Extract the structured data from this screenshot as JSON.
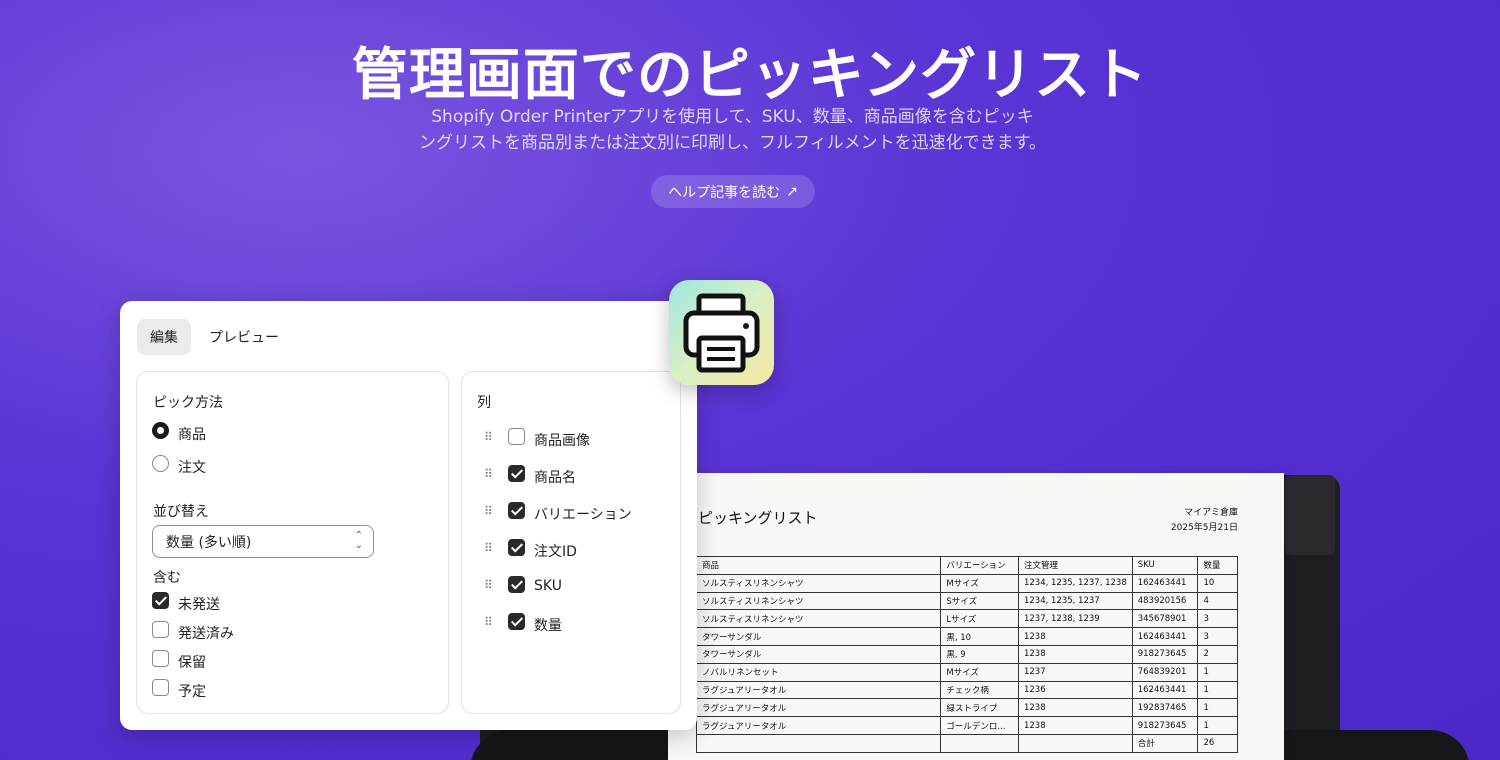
{
  "hero": {
    "title": "管理画面でのピッキングリスト",
    "subtitle_line1": "Shopify Order Printerアプリを使用して、SKU、数量、商品画像を含むピッキ",
    "subtitle_line2": "ングリストを商品別または注文別に印刷し、フルフィルメントを迅速化できます。",
    "help_label": "ヘルプ記事を読む",
    "help_icon": "arrow-up-right-icon"
  },
  "editor": {
    "tabs": [
      {
        "label": "編集",
        "active": true
      },
      {
        "label": "プレビュー",
        "active": false
      }
    ],
    "pick_method": {
      "label": "ピック方法",
      "options": [
        {
          "label": "商品",
          "checked": true
        },
        {
          "label": "注文",
          "checked": false
        }
      ]
    },
    "sort": {
      "label": "並び替え",
      "value": "数量 (多い順)"
    },
    "include": {
      "label": "含む",
      "options": [
        {
          "label": "未発送",
          "checked": true
        },
        {
          "label": "発送済み",
          "checked": false
        },
        {
          "label": "保留",
          "checked": false
        },
        {
          "label": "予定",
          "checked": false
        }
      ]
    },
    "columns": {
      "label": "列",
      "items": [
        {
          "label": "商品画像",
          "checked": false
        },
        {
          "label": "商品名",
          "checked": true
        },
        {
          "label": "バリエーション",
          "checked": true
        },
        {
          "label": "注文ID",
          "checked": true
        },
        {
          "label": "SKU",
          "checked": true
        },
        {
          "label": "数量",
          "checked": true
        }
      ]
    }
  },
  "app_icon": "printer-icon",
  "picklist": {
    "title": "ピッキングリスト",
    "warehouse": "マイアミ倉庫",
    "date": "2025年5月21日",
    "headers": [
      "商品",
      "バリエーション",
      "注文管理",
      "SKU",
      "数量"
    ],
    "rows": [
      [
        "ソルスティスリネンシャツ",
        "Mサイズ",
        "1234, 1235, 1237, 1238",
        "162463441",
        "10"
      ],
      [
        "ソルスティスリネンシャツ",
        "Sサイズ",
        "1234, 1235, 1237",
        "483920156",
        "4"
      ],
      [
        "ソルスティスリネンシャツ",
        "Lサイズ",
        "1237, 1238, 1239",
        "345678901",
        "3"
      ],
      [
        "タワーサンダル",
        "黒, 10",
        "1238",
        "162463441",
        "3"
      ],
      [
        "タワーサンダル",
        "黒, 9",
        "1238",
        "918273645",
        "2"
      ],
      [
        "ノバルリネンセット",
        "Mサイズ",
        "1237",
        "764839201",
        "1"
      ],
      [
        "ラグジュアリータオル",
        "チェック柄",
        "1236",
        "162463441",
        "1"
      ],
      [
        "ラグジュアリータオル",
        "緑ストライプ",
        "1238",
        "192837465",
        "1"
      ],
      [
        "ラグジュアリータオル",
        "ゴールデンロ...",
        "1238",
        "918273645",
        "1"
      ]
    ],
    "total_label": "合計",
    "total_value": "26"
  }
}
